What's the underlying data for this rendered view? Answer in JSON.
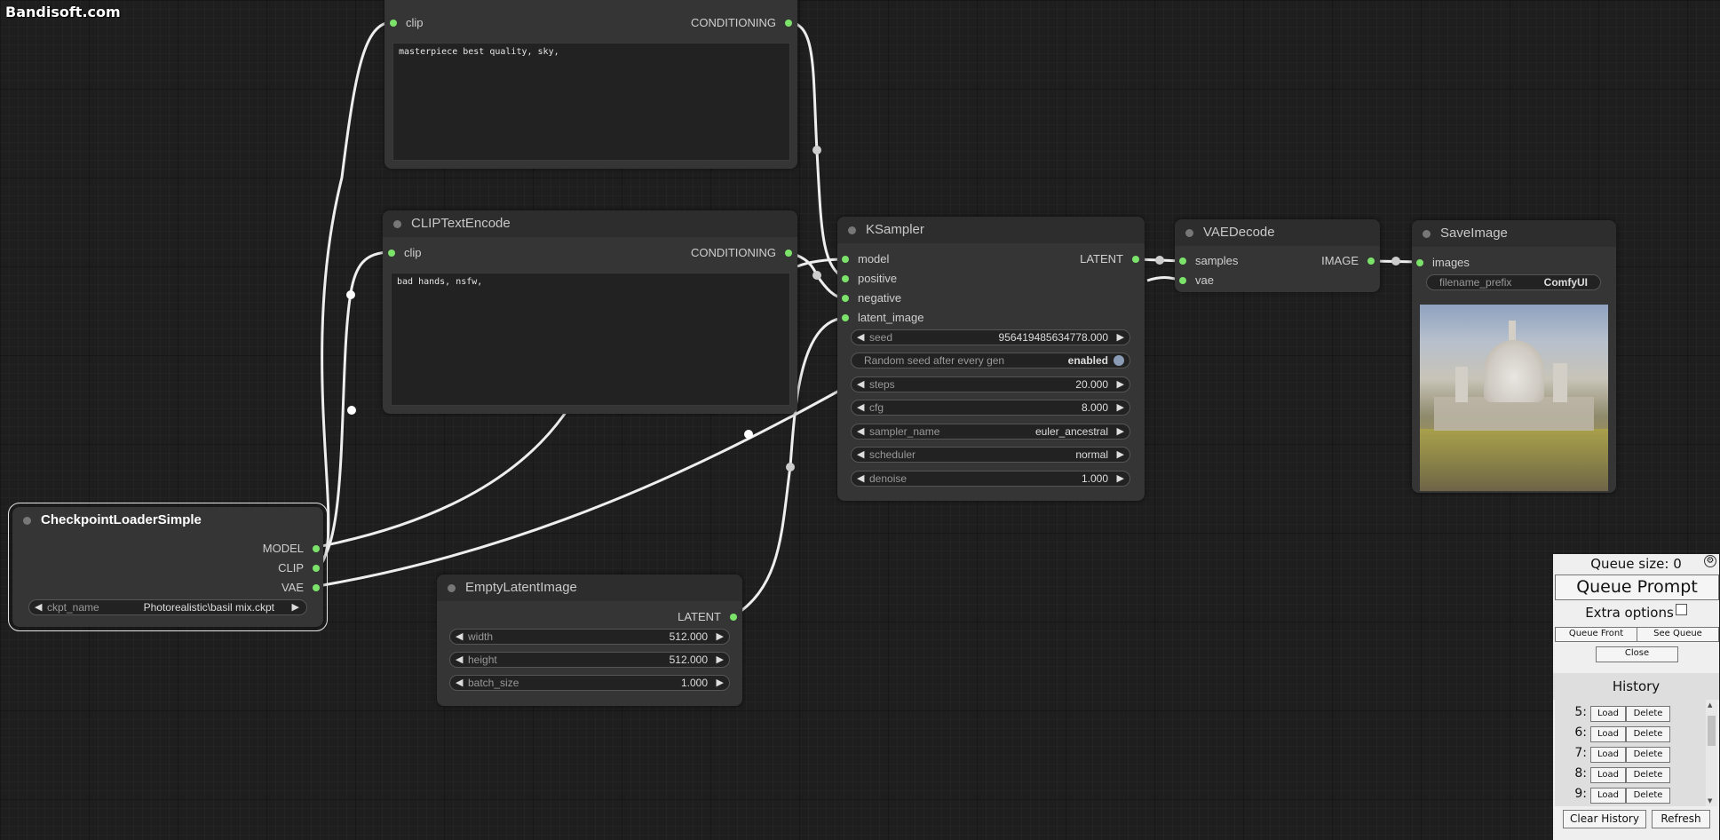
{
  "watermark": "Bandisoft.com",
  "nodes": {
    "clip_positive": {
      "input_clip": "clip",
      "output": "CONDITIONING",
      "text": "masterpiece best quality, sky,"
    },
    "clip_negative": {
      "title": "CLIPTextEncode",
      "input_clip": "clip",
      "output": "CONDITIONING",
      "text": "bad hands, nsfw,"
    },
    "checkpoint": {
      "title": "CheckpointLoaderSimple",
      "outputs": [
        "MODEL",
        "CLIP",
        "VAE"
      ],
      "ckpt_name_label": "ckpt_name",
      "ckpt_name_value": "Photorealistic\\basil mix.ckpt"
    },
    "empty_latent": {
      "title": "EmptyLatentImage",
      "output": "LATENT",
      "widgets": [
        {
          "name": "width",
          "value": "512.000"
        },
        {
          "name": "height",
          "value": "512.000"
        },
        {
          "name": "batch_size",
          "value": "1.000"
        }
      ]
    },
    "ksampler": {
      "title": "KSampler",
      "inputs": [
        "model",
        "positive",
        "negative",
        "latent_image"
      ],
      "output": "LATENT",
      "widgets": [
        {
          "name": "seed",
          "value": "956419485634778.000"
        },
        {
          "name": "Random seed after every gen",
          "value": "enabled"
        },
        {
          "name": "steps",
          "value": "20.000"
        },
        {
          "name": "cfg",
          "value": "8.000"
        },
        {
          "name": "sampler_name",
          "value": "euler_ancestral"
        },
        {
          "name": "scheduler",
          "value": "normal"
        },
        {
          "name": "denoise",
          "value": "1.000"
        }
      ]
    },
    "vae_decode": {
      "title": "VAEDecode",
      "inputs": [
        "samples",
        "vae"
      ],
      "output": "IMAGE"
    },
    "save_image": {
      "title": "SaveImage",
      "input": "images",
      "filename_prefix_label": "filename_prefix",
      "filename_prefix_value": "ComfyUI"
    }
  },
  "panel": {
    "queue_size": "Queue size: 0",
    "queue_prompt": "Queue Prompt",
    "extra_options": "Extra options",
    "queue_front": "Queue Front",
    "see_queue": "See Queue",
    "close": "Close",
    "history_title": "History",
    "history": [
      {
        "num": "5:",
        "load": "Load",
        "delete": "Delete"
      },
      {
        "num": "6:",
        "load": "Load",
        "delete": "Delete"
      },
      {
        "num": "7:",
        "load": "Load",
        "delete": "Delete"
      },
      {
        "num": "8:",
        "load": "Load",
        "delete": "Delete"
      },
      {
        "num": "9:",
        "load": "Load",
        "delete": "Delete"
      }
    ],
    "clear_history": "Clear History",
    "refresh": "Refresh"
  },
  "colors": {
    "canvas": "#1e1e1e",
    "node_body": "#353535",
    "node_title": "#2d2d2d",
    "slot_connected": "#7ce36a",
    "link": "#e6e6e6",
    "panel": "#efefef"
  }
}
